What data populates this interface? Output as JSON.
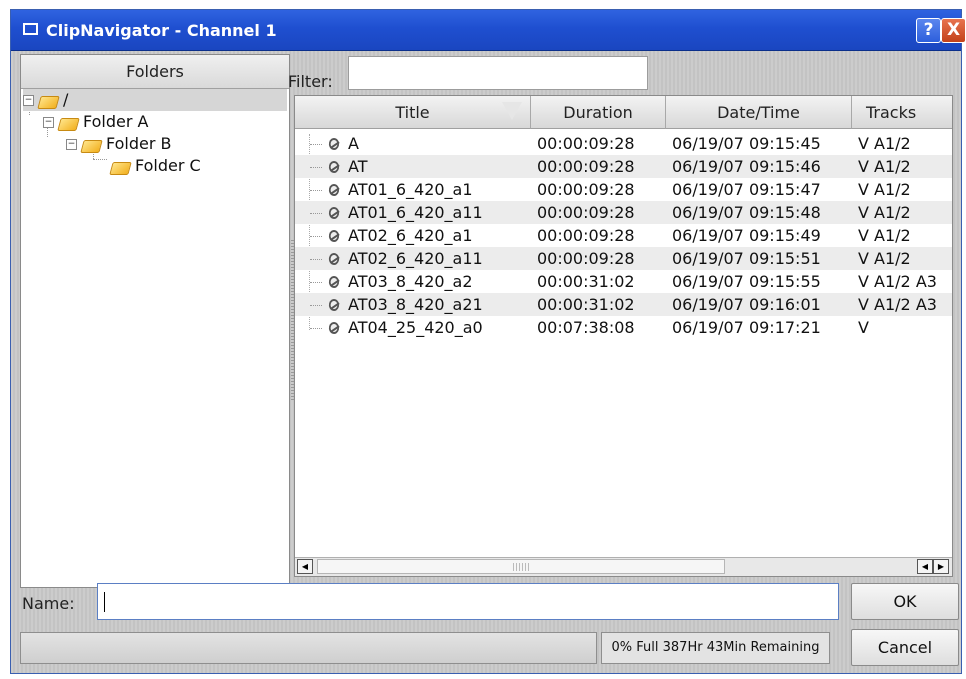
{
  "window": {
    "title": "ClipNavigator - Channel 1",
    "help_label": "?",
    "close_label": "X"
  },
  "folders": {
    "header": "Folders",
    "items": [
      {
        "label": "/",
        "expander": "⊟"
      },
      {
        "label": "Folder A",
        "expander": "⊟"
      },
      {
        "label": "Folder B",
        "expander": "⊟"
      },
      {
        "label": "Folder C",
        "expander": ""
      }
    ]
  },
  "filter": {
    "label": "Filter:",
    "value": ""
  },
  "table": {
    "columns": [
      "Title",
      "Duration",
      "Date/Time",
      "Tracks"
    ],
    "rows": [
      {
        "title": "A",
        "duration": "00:00:09:28",
        "datetime": "06/19/07 09:15:45",
        "tracks": "V A1/2"
      },
      {
        "title": "AT",
        "duration": "00:00:09:28",
        "datetime": "06/19/07 09:15:46",
        "tracks": "V A1/2"
      },
      {
        "title": "AT01_6_420_a1",
        "duration": "00:00:09:28",
        "datetime": "06/19/07 09:15:47",
        "tracks": "V A1/2"
      },
      {
        "title": "AT01_6_420_a11",
        "duration": "00:00:09:28",
        "datetime": "06/19/07 09:15:48",
        "tracks": "V A1/2"
      },
      {
        "title": "AT02_6_420_a1",
        "duration": "00:00:09:28",
        "datetime": "06/19/07 09:15:49",
        "tracks": "V A1/2"
      },
      {
        "title": "AT02_6_420_a11",
        "duration": "00:00:09:28",
        "datetime": "06/19/07 09:15:51",
        "tracks": "V A1/2"
      },
      {
        "title": "AT03_8_420_a2",
        "duration": "00:00:31:02",
        "datetime": "06/19/07 09:15:55",
        "tracks": "V A1/2 A3"
      },
      {
        "title": "AT03_8_420_a21",
        "duration": "00:00:31:02",
        "datetime": "06/19/07 09:16:01",
        "tracks": "V A1/2 A3"
      },
      {
        "title": "AT04_25_420_a0",
        "duration": "00:07:38:08",
        "datetime": "06/19/07 09:17:21",
        "tracks": "V"
      }
    ]
  },
  "scrollbar": {
    "left_arrow": "◀",
    "right_arrow_a": "◀",
    "right_arrow_b": "▶"
  },
  "name": {
    "label": "Name:",
    "value": ""
  },
  "buttons": {
    "ok": "OK",
    "cancel": "Cancel"
  },
  "status": {
    "text": "0% Full  387Hr 43Min Remaining",
    "progress_fraction": 0.0
  }
}
